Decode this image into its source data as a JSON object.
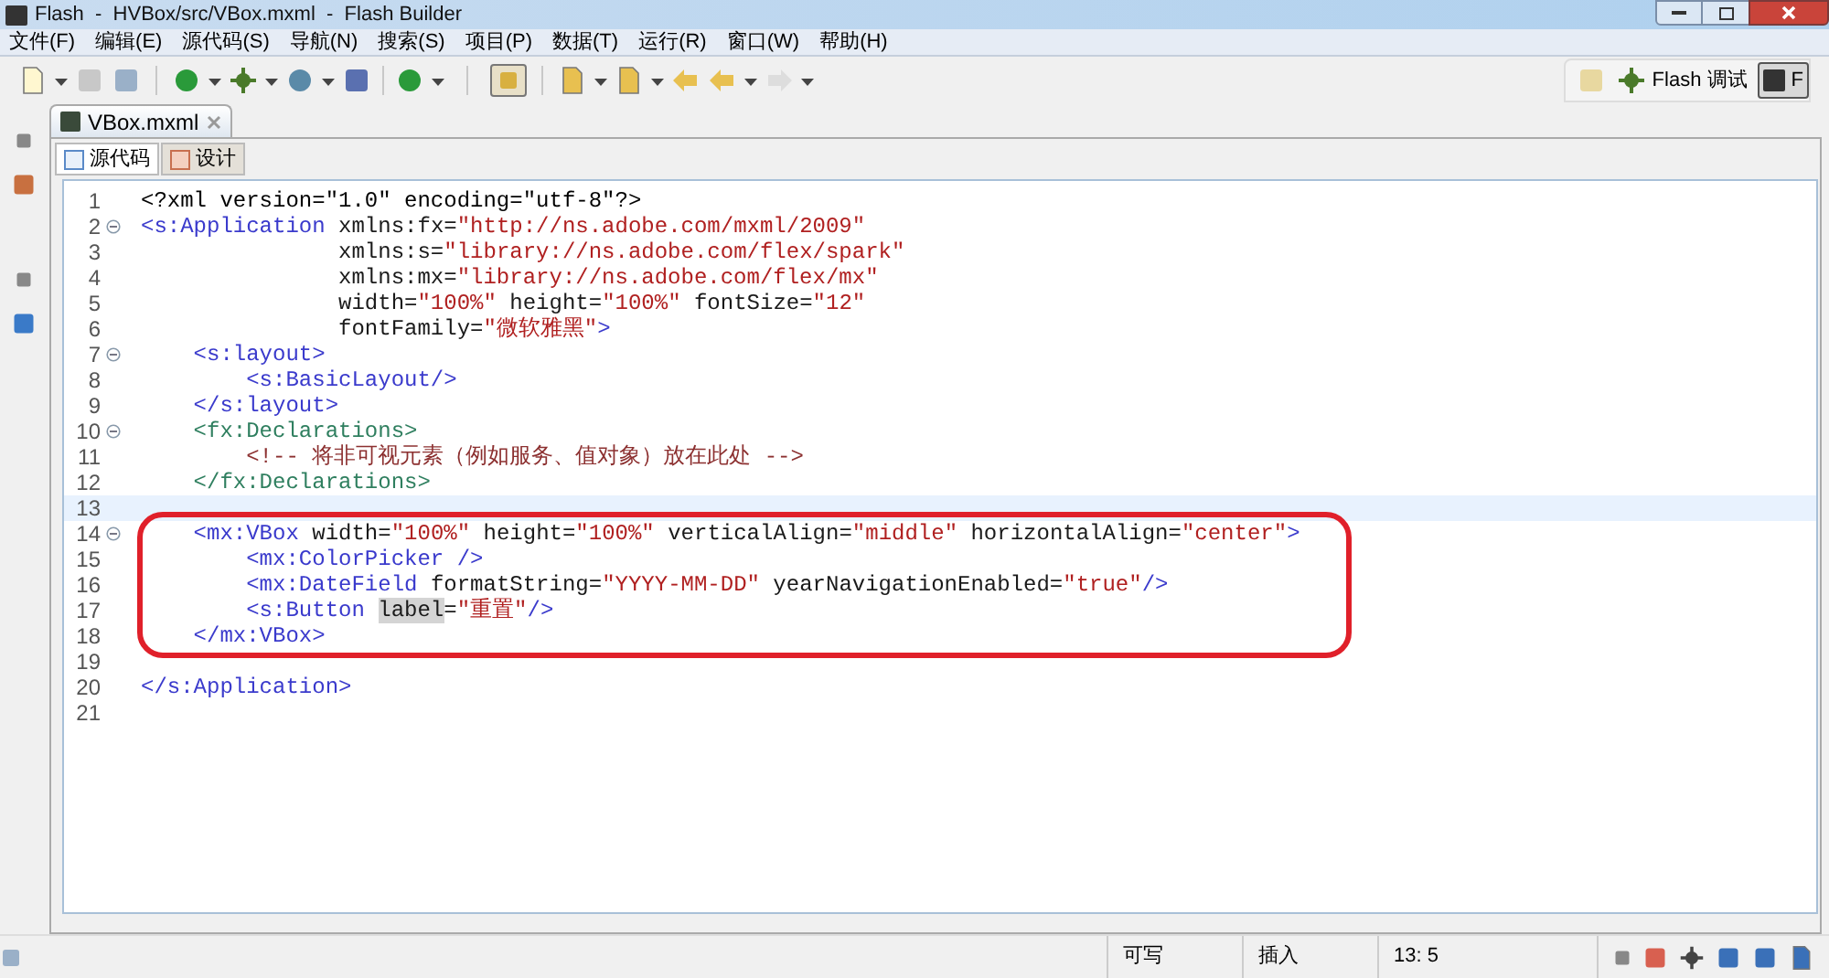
{
  "window": {
    "title": "Flash  -  HVBox/src/VBox.mxml  -  Flash Builder"
  },
  "menu": [
    "文件(F)",
    "编辑(E)",
    "源代码(S)",
    "导航(N)",
    "搜索(S)",
    "项目(P)",
    "数据(T)",
    "运行(R)",
    "窗口(W)",
    "帮助(H)"
  ],
  "perspectives": [
    {
      "label": "Flash 调试",
      "selected": false
    },
    {
      "label": "F",
      "selected": true
    }
  ],
  "editor_tab": {
    "label": "VBox.mxml"
  },
  "view_tabs": [
    {
      "label": "源代码",
      "selected": true
    },
    {
      "label": "设计",
      "selected": false
    }
  ],
  "lines": [
    {
      "number": "1",
      "fold": false,
      "current": false,
      "circled": false,
      "tokens": [
        {
          "kind": "plain",
          "text": "<?xml version=\"1.0\" encoding=\"utf-8\"?>"
        }
      ]
    },
    {
      "number": "2",
      "fold": true,
      "current": false,
      "circled": false,
      "tokens": [
        {
          "kind": "tag",
          "text": "<s:Application "
        },
        {
          "kind": "attr",
          "text": "xmlns:fx="
        },
        {
          "kind": "value",
          "text": "\"http://ns.adobe.com/mxml/2009\""
        }
      ]
    },
    {
      "number": "3",
      "fold": false,
      "current": false,
      "circled": false,
      "tokens": [
        {
          "kind": "attr",
          "text": "               xmlns:s="
        },
        {
          "kind": "value",
          "text": "\"library://ns.adobe.com/flex/spark\""
        }
      ]
    },
    {
      "number": "4",
      "fold": false,
      "current": false,
      "circled": false,
      "tokens": [
        {
          "kind": "attr",
          "text": "               xmlns:mx="
        },
        {
          "kind": "value",
          "text": "\"library://ns.adobe.com/flex/mx\""
        }
      ]
    },
    {
      "number": "5",
      "fold": false,
      "current": false,
      "circled": false,
      "tokens": [
        {
          "kind": "attr",
          "text": "               width="
        },
        {
          "kind": "value",
          "text": "\"100%\""
        },
        {
          "kind": "attr",
          "text": " height="
        },
        {
          "kind": "value",
          "text": "\"100%\""
        },
        {
          "kind": "attr",
          "text": " fontSize="
        },
        {
          "kind": "value",
          "text": "\"12\""
        }
      ]
    },
    {
      "number": "6",
      "fold": false,
      "current": false,
      "circled": false,
      "tokens": [
        {
          "kind": "attr",
          "text": "               fontFamily="
        },
        {
          "kind": "value",
          "text": "\"微软雅黑\""
        },
        {
          "kind": "tag",
          "text": ">"
        }
      ]
    },
    {
      "number": "7",
      "fold": true,
      "current": false,
      "circled": false,
      "tokens": [
        {
          "kind": "tag",
          "text": "    <s:layout>"
        }
      ]
    },
    {
      "number": "8",
      "fold": false,
      "current": false,
      "circled": false,
      "tokens": [
        {
          "kind": "tag",
          "text": "        <s:BasicLayout/>"
        }
      ]
    },
    {
      "number": "9",
      "fold": false,
      "current": false,
      "circled": false,
      "tokens": [
        {
          "kind": "tag",
          "text": "    </s:layout>"
        }
      ]
    },
    {
      "number": "10",
      "fold": true,
      "current": false,
      "circled": false,
      "tokens": [
        {
          "kind": "fxtag",
          "text": "    <fx:Declarations>"
        }
      ]
    },
    {
      "number": "11",
      "fold": false,
      "current": false,
      "circled": false,
      "tokens": [
        {
          "kind": "comment",
          "text": "        <!-- 将非可视元素（例如服务、值对象）放在此处 -->"
        }
      ]
    },
    {
      "number": "12",
      "fold": false,
      "current": false,
      "circled": false,
      "tokens": [
        {
          "kind": "fxtag",
          "text": "    </fx:Declarations>"
        }
      ]
    },
    {
      "number": "13",
      "fold": false,
      "current": true,
      "circled": false
    },
    {
      "number": "14",
      "fold": true,
      "current": false,
      "circled": true,
      "tokens": [
        {
          "kind": "tag",
          "text": "    <mx:VBox "
        },
        {
          "kind": "attr",
          "text": "width="
        },
        {
          "kind": "value",
          "text": "\"100%\""
        },
        {
          "kind": "attr",
          "text": " height="
        },
        {
          "kind": "value",
          "text": "\"100%\""
        },
        {
          "kind": "attr",
          "text": " verticalAlign="
        },
        {
          "kind": "value",
          "text": "\"middle\""
        },
        {
          "kind": "attr",
          "text": " horizontalAlign="
        },
        {
          "kind": "value",
          "text": "\"center\""
        },
        {
          "kind": "tag",
          "text": ">"
        }
      ]
    },
    {
      "number": "15",
      "fold": false,
      "current": false,
      "circled": true,
      "tokens": [
        {
          "kind": "tag",
          "text": "        <mx:ColorPicker />"
        }
      ]
    },
    {
      "number": "16",
      "fold": false,
      "current": false,
      "circled": true,
      "tokens": [
        {
          "kind": "tag",
          "text": "        <mx:DateField "
        },
        {
          "kind": "attr",
          "text": "formatString="
        },
        {
          "kind": "value",
          "text": "\"YYYY-MM-DD\""
        },
        {
          "kind": "attr",
          "text": " yearNavigationEnabled="
        },
        {
          "kind": "value",
          "text": "\"true\""
        },
        {
          "kind": "tag",
          "text": "/>"
        }
      ]
    },
    {
      "number": "17",
      "fold": false,
      "current": false,
      "circled": true,
      "tokens": [
        {
          "kind": "tag",
          "text": "        <s:Button "
        },
        {
          "kind": "selected",
          "text": "label"
        },
        {
          "kind": "attr",
          "text": "="
        },
        {
          "kind": "value",
          "text": "\"重置\""
        },
        {
          "kind": "tag",
          "text": "/>"
        }
      ]
    },
    {
      "number": "18",
      "fold": false,
      "current": false,
      "circled": true,
      "tokens": [
        {
          "kind": "tag",
          "text": "    </mx:VBox>"
        }
      ]
    },
    {
      "number": "19",
      "fold": false,
      "current": false,
      "circled": false
    },
    {
      "number": "20",
      "fold": false,
      "current": false,
      "circled": false,
      "tokens": [
        {
          "kind": "tag",
          "text": "</s:Application>"
        }
      ]
    },
    {
      "number": "21",
      "fold": false,
      "current": false,
      "circled": false
    }
  ],
  "status_bar": [
    "可写",
    "插入",
    "13: 5"
  ]
}
